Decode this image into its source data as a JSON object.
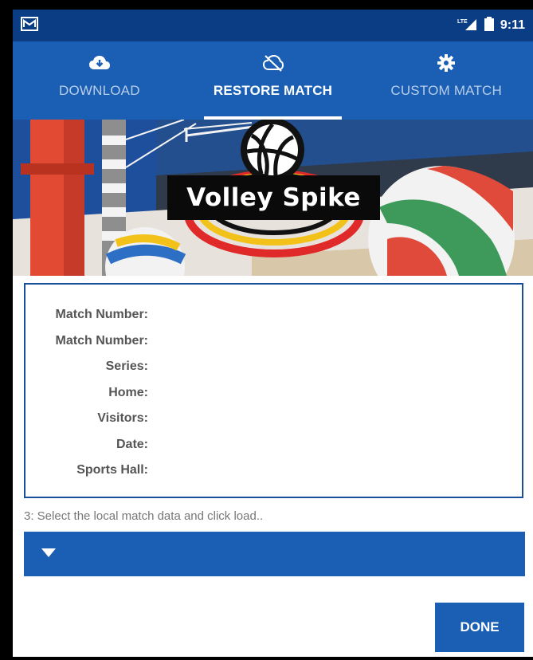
{
  "status_bar": {
    "time": "9:11",
    "network": "LTE"
  },
  "tabs": [
    {
      "label": "DOWNLOAD",
      "icon": "cloud-download-icon",
      "active": false
    },
    {
      "label": "RESTORE MATCH",
      "icon": "cloud-off-icon",
      "active": true
    },
    {
      "label": "CUSTOM MATCH",
      "icon": "gear-icon",
      "active": false
    }
  ],
  "banner": {
    "title": "Volley Spike"
  },
  "match_info": {
    "fields": [
      {
        "label": "Match Number:",
        "value": ""
      },
      {
        "label": "Match Number:",
        "value": ""
      },
      {
        "label": "Series:",
        "value": ""
      },
      {
        "label": "Home:",
        "value": ""
      },
      {
        "label": "Visitors:",
        "value": ""
      },
      {
        "label": "Date:",
        "value": ""
      },
      {
        "label": "Sports Hall:",
        "value": ""
      }
    ]
  },
  "instruction": "3: Select the local match data and click load..",
  "match_select": {
    "selected": ""
  },
  "done_label": "DONE",
  "colors": {
    "primary": "#1a5fb4",
    "status_bar": "#0a3d84",
    "card_border": "#1a4f99"
  }
}
